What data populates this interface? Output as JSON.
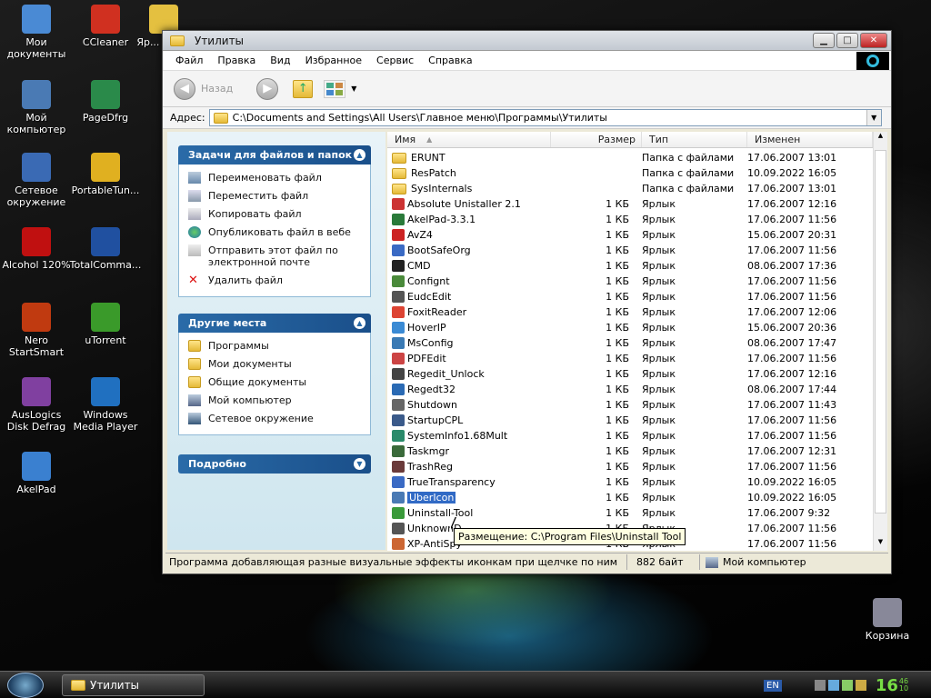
{
  "desktop": {
    "icons": [
      {
        "label": "Мои документы",
        "color": "#4a8ad4"
      },
      {
        "label": "CCleaner",
        "color": "#d03020"
      },
      {
        "label": "Яр... Ути...",
        "color": "#e4c040"
      },
      {
        "label": "Мой компьютер",
        "color": "#4a7ab4"
      },
      {
        "label": "PageDfrg",
        "color": "#2a8a4a"
      },
      {
        "label": "Сетевое окружение",
        "color": "#3a6ab4"
      },
      {
        "label": "PortableTun...",
        "color": "#e0b020"
      },
      {
        "label": "Alcohol 120%",
        "color": "#c01010"
      },
      {
        "label": "TotalComma...",
        "color": "#2050a0"
      },
      {
        "label": "Nero StartSmart",
        "color": "#c03a10"
      },
      {
        "label": "uTorrent",
        "color": "#3a9a2a"
      },
      {
        "label": "AusLogics Disk Defrag",
        "color": "#8040a0"
      },
      {
        "label": "Windows Media Player",
        "color": "#2070c0"
      },
      {
        "label": "AkelPad",
        "color": "#3a80d0"
      },
      {
        "label": "Корзина",
        "color": "#889"
      }
    ]
  },
  "window": {
    "title": "Утилиты",
    "menu": [
      "Файл",
      "Правка",
      "Вид",
      "Избранное",
      "Сервис",
      "Справка"
    ],
    "toolbar": {
      "back": "Назад"
    },
    "address": {
      "label": "Адрес:",
      "path": "C:\\Documents and Settings\\All Users\\Главное меню\\Программы\\Утилиты"
    },
    "tasks": {
      "title": "Задачи для файлов и папок",
      "items": [
        "Переименовать файл",
        "Переместить файл",
        "Копировать файл",
        "Опубликовать файл в вебе",
        "Отправить этот файл по электронной почте",
        "Удалить файл"
      ]
    },
    "places": {
      "title": "Другие места",
      "items": [
        "Программы",
        "Мои документы",
        "Общие документы",
        "Мой компьютер",
        "Сетевое окружение"
      ]
    },
    "details": {
      "title": "Подробно"
    },
    "columns": {
      "name": "Имя",
      "size": "Размер",
      "type": "Тип",
      "date": "Изменен"
    },
    "files": [
      {
        "name": "ERUNT",
        "size": "",
        "type": "Папка с файлами",
        "date": "17.06.2007 13:01",
        "icon": "folder"
      },
      {
        "name": "ResPatch",
        "size": "",
        "type": "Папка с файлами",
        "date": "10.09.2022 16:05",
        "icon": "folder"
      },
      {
        "name": "SysInternals",
        "size": "",
        "type": "Папка с файлами",
        "date": "17.06.2007 13:01",
        "icon": "folder"
      },
      {
        "name": "Absolute Unistaller 2.1",
        "size": "1 КБ",
        "type": "Ярлык",
        "date": "17.06.2007 12:16",
        "icon": "#c33"
      },
      {
        "name": "AkelPad-3.3.1",
        "size": "1 КБ",
        "type": "Ярлык",
        "date": "17.06.2007 11:56",
        "icon": "#2a7a3a"
      },
      {
        "name": "AvZ4",
        "size": "1 КБ",
        "type": "Ярлык",
        "date": "15.06.2007 20:31",
        "icon": "#c22"
      },
      {
        "name": "BootSafeOrg",
        "size": "1 КБ",
        "type": "Ярлык",
        "date": "17.06.2007 11:56",
        "icon": "#3a6ac4"
      },
      {
        "name": "CMD",
        "size": "1 КБ",
        "type": "Ярлык",
        "date": "08.06.2007 17:36",
        "icon": "#222"
      },
      {
        "name": "Confignt",
        "size": "1 КБ",
        "type": "Ярлык",
        "date": "17.06.2007 11:56",
        "icon": "#4a8a3a"
      },
      {
        "name": "EudcEdit",
        "size": "1 КБ",
        "type": "Ярлык",
        "date": "17.06.2007 11:56",
        "icon": "#555"
      },
      {
        "name": "FoxitReader",
        "size": "1 КБ",
        "type": "Ярлык",
        "date": "17.06.2007 12:06",
        "icon": "#d43"
      },
      {
        "name": "HoverIP",
        "size": "1 КБ",
        "type": "Ярлык",
        "date": "15.06.2007 20:36",
        "icon": "#3a8ad4"
      },
      {
        "name": "MsConfig",
        "size": "1 КБ",
        "type": "Ярлык",
        "date": "08.06.2007 17:47",
        "icon": "#3a7ab4"
      },
      {
        "name": "PDFEdit",
        "size": "1 КБ",
        "type": "Ярлык",
        "date": "17.06.2007 11:56",
        "icon": "#c44"
      },
      {
        "name": "Regedit_Unlock",
        "size": "1 КБ",
        "type": "Ярлык",
        "date": "17.06.2007 12:16",
        "icon": "#444"
      },
      {
        "name": "Regedt32",
        "size": "1 КБ",
        "type": "Ярлык",
        "date": "08.06.2007 17:44",
        "icon": "#2a6ab4"
      },
      {
        "name": "Shutdown",
        "size": "1 КБ",
        "type": "Ярлык",
        "date": "17.06.2007 11:43",
        "icon": "#666"
      },
      {
        "name": "StartupCPL",
        "size": "1 КБ",
        "type": "Ярлык",
        "date": "17.06.2007 11:56",
        "icon": "#3a5a8a"
      },
      {
        "name": "SystemInfo1.68Mult",
        "size": "1 КБ",
        "type": "Ярлык",
        "date": "17.06.2007 11:56",
        "icon": "#2a8a6a"
      },
      {
        "name": "Taskmgr",
        "size": "1 КБ",
        "type": "Ярлык",
        "date": "17.06.2007 12:31",
        "icon": "#3a6a3a"
      },
      {
        "name": "TrashReg",
        "size": "1 КБ",
        "type": "Ярлык",
        "date": "17.06.2007 11:56",
        "icon": "#6a3a3a"
      },
      {
        "name": "TrueTransparency",
        "size": "1 КБ",
        "type": "Ярлык",
        "date": "10.09.2022 16:05",
        "icon": "#3a6ac4"
      },
      {
        "name": "UberIcon",
        "size": "1 КБ",
        "type": "Ярлык",
        "date": "10.09.2022 16:05",
        "icon": "#4a7ab4"
      },
      {
        "name": "Uninstall-Tool",
        "size": "1 КБ",
        "type": "Ярлык",
        "date": "17.06.2007 9:32",
        "icon": "#3a9a3a"
      },
      {
        "name": "UnknownD",
        "size": "1 КБ",
        "type": "Ярлык",
        "date": "17.06.2007 11:56",
        "icon": "#555"
      },
      {
        "name": "XP-AntiSpy",
        "size": "1 КБ",
        "type": "Ярлык",
        "date": "17.06.2007 11:56",
        "icon": "#c63"
      }
    ],
    "tooltip": "Размещение: C:\\Program Files\\Uninstall Tool",
    "status": {
      "description": "Программа добавляющая разные визуальные эффекты иконкам при щелчке по ним",
      "size": "882 байт",
      "location": "Мой компьютер"
    }
  },
  "taskbar": {
    "task": "Утилиты",
    "lang": "EN",
    "clock": "16",
    "clock_small": "46 10"
  }
}
